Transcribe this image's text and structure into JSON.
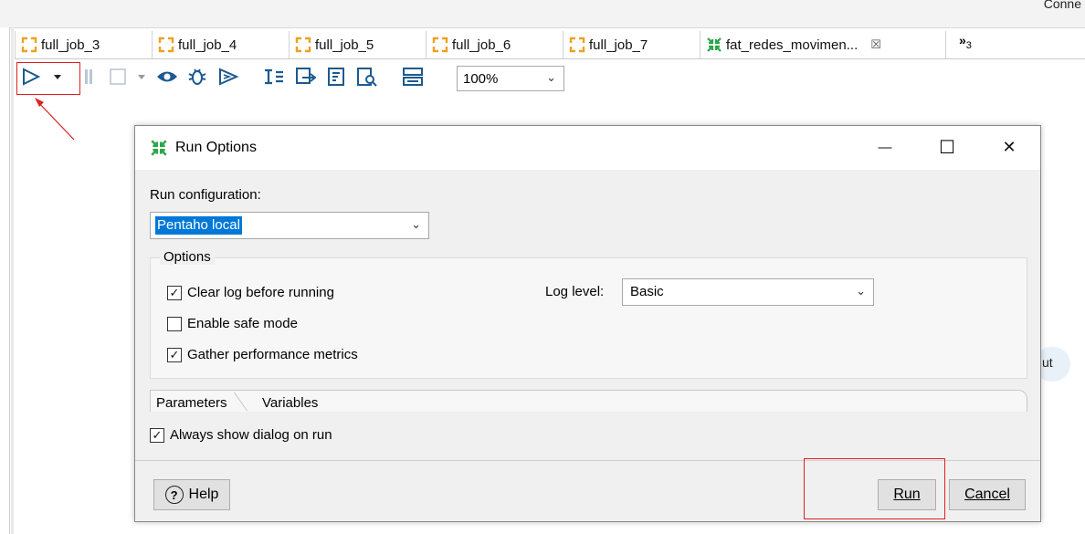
{
  "top": {
    "connect_label": "Conne"
  },
  "tabs": [
    {
      "label": "full_job_3",
      "icon": "job-icon",
      "active": false
    },
    {
      "label": "full_job_4",
      "icon": "job-icon",
      "active": false
    },
    {
      "label": "full_job_5",
      "icon": "job-icon",
      "active": false
    },
    {
      "label": "full_job_6",
      "icon": "job-icon",
      "active": false
    },
    {
      "label": "full_job_7",
      "icon": "job-icon",
      "active": false
    },
    {
      "label": "fat_redes_movimen...",
      "icon": "transformation-icon",
      "active": true,
      "close": "☒"
    }
  ],
  "tab_overflow": {
    "label": "»",
    "count": "3"
  },
  "toolbar": {
    "zoom_value": "100%",
    "icons": [
      "run-icon",
      "run-dropdown-icon",
      "pause-icon",
      "stop-icon",
      "stop-dropdown-icon",
      "preview-icon",
      "debug-icon",
      "replay-icon",
      "verify-icon",
      "impact-icon",
      "sql-icon",
      "explore-db-icon",
      "show-results-icon"
    ]
  },
  "canvas": {
    "partial_label": "ut"
  },
  "dialog": {
    "title": "Run Options",
    "minimize": "—",
    "maximize": "☐",
    "close": "✕",
    "run_configuration_label": "Run configuration:",
    "run_configuration_value": "Pentaho local",
    "options_legend": "Options",
    "clear_log": {
      "label": "Clear log before running",
      "checked": true
    },
    "safe_mode": {
      "label": "Enable safe mode",
      "checked": false
    },
    "gather_metrics": {
      "label": "Gather performance metrics",
      "checked": true
    },
    "log_level_label": "Log level:",
    "log_level_value": "Basic",
    "tabs": [
      "Parameters",
      "Variables"
    ],
    "always_show": {
      "label": "Always show dialog on run",
      "checked": true
    },
    "help_label": "Help",
    "run_label": "Run",
    "cancel_label": "Cancel"
  },
  "colors": {
    "accent": "#0078d7",
    "annotation": "#e02020",
    "job_icon": "#f0a020",
    "trans_icon": "#2aa64a",
    "toolbar_icon": "#1c5a8f"
  }
}
